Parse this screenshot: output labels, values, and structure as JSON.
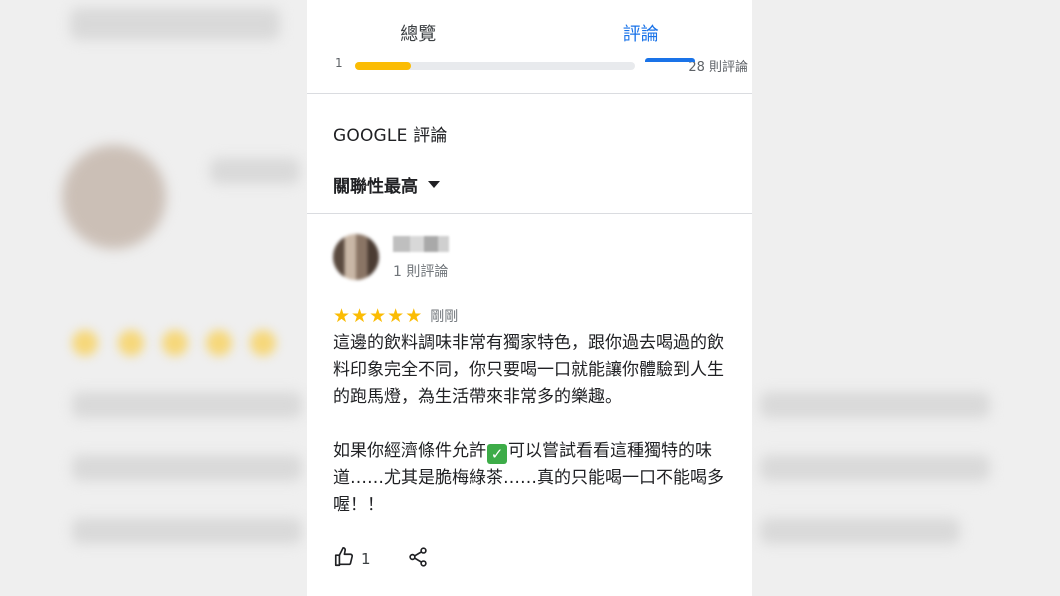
{
  "tabs": [
    {
      "label": "總覽",
      "active": false
    },
    {
      "label": "評論",
      "active": true
    }
  ],
  "rating_summary": {
    "star_level": "1",
    "fill_fraction": 0.2,
    "count_text": "28 則評論"
  },
  "section": {
    "title": "GOOGLE 評論",
    "sort_label": "關聯性最高"
  },
  "review": {
    "author_count": "1 則評論",
    "stars": 5,
    "time": "剛剛",
    "paragraph1": "這邊的飲料調味非常有獨家特色，跟你過去喝過的飲料印象完全不同，你只要喝一口就能讓你體驗到人生的跑馬燈，為生活帶來非常多的樂趣。",
    "paragraph2_before": "如果你經濟條件允許",
    "paragraph2_after": "可以嘗試看看這種獨特的味道……尤其是脆梅綠茶……真的只能喝一口不能喝多喔！！",
    "like_count": "1"
  },
  "icons": {
    "thumb": "thumbs-up-icon",
    "share": "share-icon",
    "check": "check-mark-emoji",
    "star": "star-icon",
    "caret": "dropdown-caret-icon"
  },
  "colors": {
    "accent": "#1a73e8",
    "star": "#fbbc04",
    "text": "#202124",
    "muted": "#70757a"
  }
}
